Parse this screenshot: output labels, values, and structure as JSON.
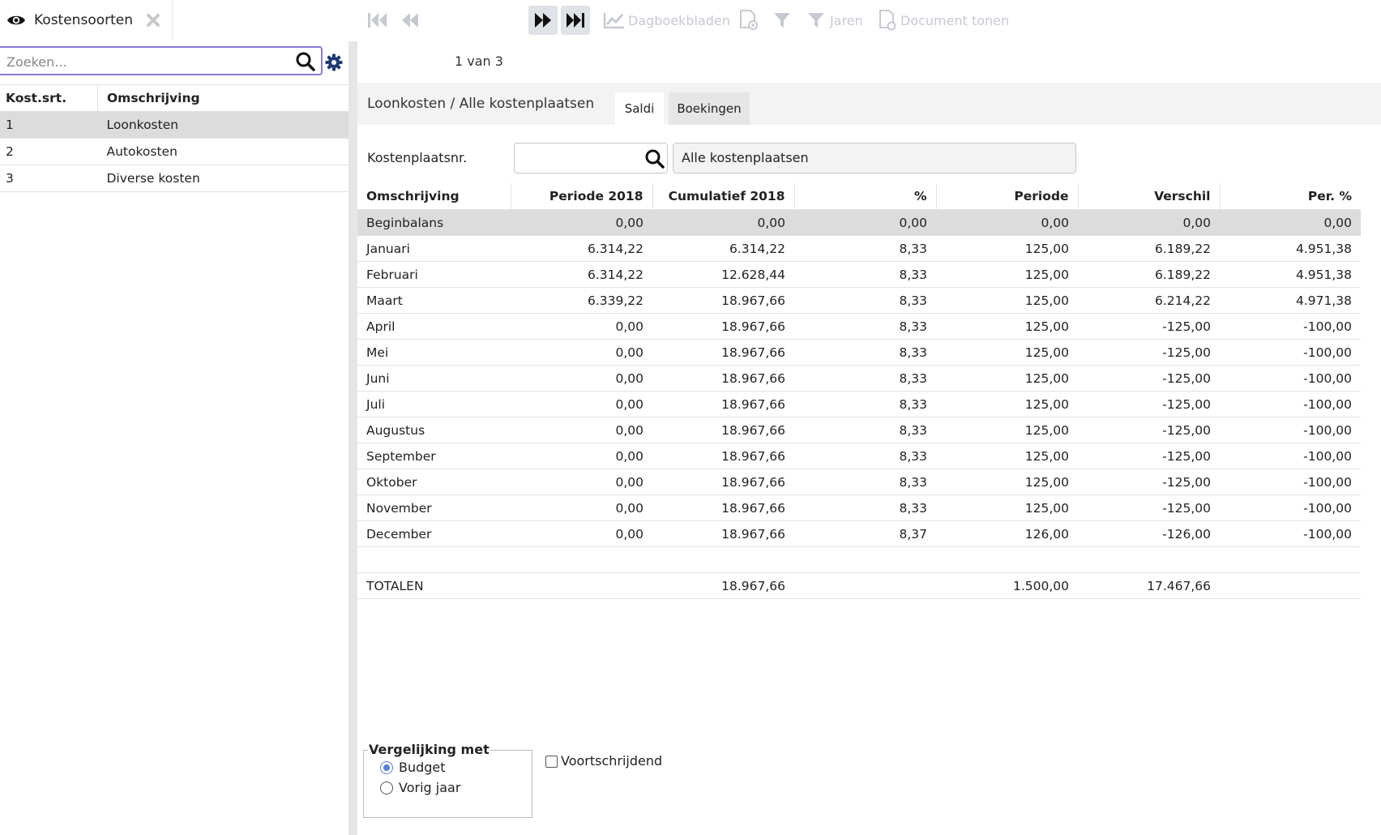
{
  "document_tab": {
    "title": "Kostensoorten"
  },
  "left_panel": {
    "search_placeholder": "Zoeken...",
    "columns": [
      "Kost.srt.",
      "Omschrijving"
    ],
    "rows": [
      {
        "code": "1",
        "description": "Loonkosten",
        "selected": true
      },
      {
        "code": "2",
        "description": "Autokosten",
        "selected": false
      },
      {
        "code": "3",
        "description": "Diverse kosten",
        "selected": false
      }
    ]
  },
  "toolbar": {
    "pager": "1 van 3",
    "dagboekbladen": "Dagboekbladen",
    "jaren": "Jaren",
    "document_tonen": "Document tonen"
  },
  "header": {
    "breadcrumb": "Loonkosten / Alle kostenplaatsen",
    "tabs": [
      {
        "label": "Saldi",
        "active": true
      },
      {
        "label": "Boekingen",
        "active": false
      }
    ]
  },
  "filter": {
    "kostenplaats_label": "Kostenplaatsnr.",
    "kostenplaats_value": "",
    "kostenplaats_name": "Alle kostenplaatsen"
  },
  "table": {
    "columns": [
      "Omschrijving",
      "Periode 2018",
      "Cumulatief 2018",
      "%",
      "Periode",
      "Verschil",
      "Per. %"
    ],
    "rows": [
      [
        "Beginbalans",
        "0,00",
        "0,00",
        "0,00",
        "0,00",
        "0,00",
        "0,00"
      ],
      [
        "Januari",
        "6.314,22",
        "6.314,22",
        "8,33",
        "125,00",
        "6.189,22",
        "4.951,38"
      ],
      [
        "Februari",
        "6.314,22",
        "12.628,44",
        "8,33",
        "125,00",
        "6.189,22",
        "4.951,38"
      ],
      [
        "Maart",
        "6.339,22",
        "18.967,66",
        "8,33",
        "125,00",
        "6.214,22",
        "4.971,38"
      ],
      [
        "April",
        "0,00",
        "18.967,66",
        "8,33",
        "125,00",
        "-125,00",
        "-100,00"
      ],
      [
        "Mei",
        "0,00",
        "18.967,66",
        "8,33",
        "125,00",
        "-125,00",
        "-100,00"
      ],
      [
        "Juni",
        "0,00",
        "18.967,66",
        "8,33",
        "125,00",
        "-125,00",
        "-100,00"
      ],
      [
        "Juli",
        "0,00",
        "18.967,66",
        "8,33",
        "125,00",
        "-125,00",
        "-100,00"
      ],
      [
        "Augustus",
        "0,00",
        "18.967,66",
        "8,33",
        "125,00",
        "-125,00",
        "-100,00"
      ],
      [
        "September",
        "0,00",
        "18.967,66",
        "8,33",
        "125,00",
        "-125,00",
        "-100,00"
      ],
      [
        "Oktober",
        "0,00",
        "18.967,66",
        "8,33",
        "125,00",
        "-125,00",
        "-100,00"
      ],
      [
        "November",
        "0,00",
        "18.967,66",
        "8,33",
        "125,00",
        "-125,00",
        "-100,00"
      ],
      [
        "December",
        "0,00",
        "18.967,66",
        "8,37",
        "126,00",
        "-126,00",
        "-100,00"
      ],
      [
        "",
        "",
        "",
        "",
        "",
        "",
        ""
      ],
      [
        "TOTALEN",
        "",
        "18.967,66",
        "",
        "1.500,00",
        "17.467,66",
        ""
      ]
    ]
  },
  "comparison": {
    "legend": "Vergelijking met",
    "options": [
      {
        "label": "Budget",
        "checked": true
      },
      {
        "label": "Vorig jaar",
        "checked": false
      }
    ],
    "voortschrijdend_label": "Voortschrijdend",
    "voortschrijdend_checked": false
  },
  "colors": {
    "accent": "#5b7fd6",
    "focus_border": "#8a7ad8",
    "selected_row": "#dcdcdc",
    "disabled_icon": "#c6cad0",
    "icon_dark": "#111111"
  },
  "icons": [
    "eye-icon",
    "close-icon",
    "search-icon",
    "gear-icon",
    "first-page-icon",
    "previous-page-icon",
    "next-page-icon",
    "last-page-icon",
    "chart-icon",
    "document-preview-icon",
    "filter-icon",
    "document-icon"
  ]
}
